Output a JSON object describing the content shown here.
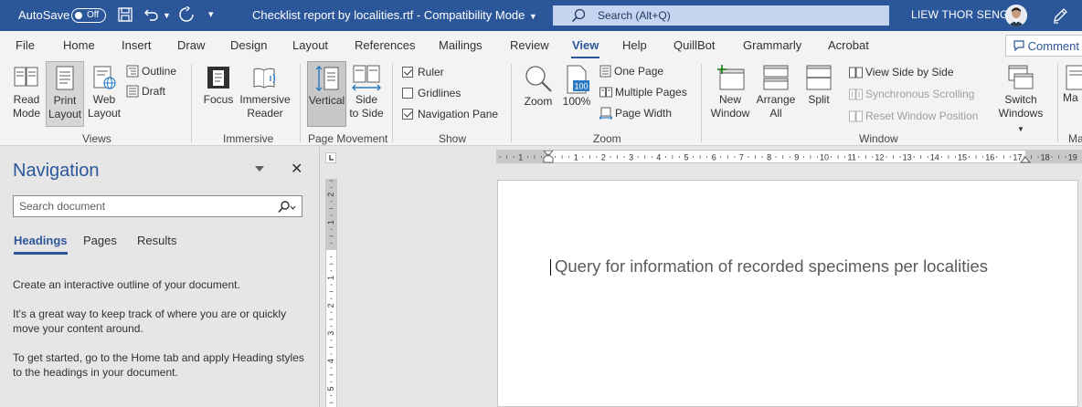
{
  "titlebar": {
    "autosave_label": "AutoSave",
    "autosave_state": "Off",
    "doc_title": "Checklist report by localities.rtf  -  Compatibility Mode",
    "search_placeholder": "Search (Alt+Q)",
    "user_name": "LIEW THOR SENG",
    "bg_color": "#2b579a"
  },
  "tabs": [
    "File",
    "Home",
    "Insert",
    "Draw",
    "Design",
    "Layout",
    "References",
    "Mailings",
    "Review",
    "View",
    "Help",
    "QuillBot",
    "Grammarly",
    "Acrobat"
  ],
  "active_tab": "View",
  "comments_label": "Comment",
  "ribbon": {
    "views": {
      "read_mode": [
        "Read",
        "Mode"
      ],
      "print_layout": [
        "Print",
        "Layout"
      ],
      "web_layout": [
        "Web",
        "Layout"
      ],
      "outline": "Outline",
      "draft": "Draft",
      "label": "Views"
    },
    "immersive": {
      "focus": "Focus",
      "immersive_reader": [
        "Immersive",
        "Reader"
      ],
      "label": "Immersive"
    },
    "page_movement": {
      "vertical": "Vertical",
      "side_to_side": [
        "Side",
        "to Side"
      ],
      "label": "Page Movement"
    },
    "show": {
      "ruler": "Ruler",
      "gridlines": "Gridlines",
      "navigation_pane": "Navigation Pane",
      "label": "Show"
    },
    "zoom": {
      "zoom": "Zoom",
      "hundred": "100%",
      "one_page": "One Page",
      "multiple_pages": "Multiple Pages",
      "page_width": "Page Width",
      "label": "Zoom"
    },
    "window": {
      "new_window": [
        "New",
        "Window"
      ],
      "arrange_all": [
        "Arrange",
        "All"
      ],
      "split": "Split",
      "view_side_by_side": "View Side by Side",
      "sync_scrolling": "Synchronous Scrolling",
      "reset_position": "Reset Window Position",
      "switch_windows": [
        "Switch",
        "Windows"
      ],
      "label": "Window"
    },
    "macros": {
      "label": "Ma",
      "button": "Ma"
    }
  },
  "navigation": {
    "title": "Navigation",
    "search_placeholder": "Search document",
    "tabs": [
      "Headings",
      "Pages",
      "Results"
    ],
    "paragraphs": [
      "Create an interactive outline of your document.",
      "It's a great way to keep track of where you are or quickly move your content around.",
      "To get started, go to the Home tab and apply Heading styles to the headings in your document."
    ]
  },
  "document": {
    "text": "Query for information of recorded specimens per localities"
  },
  "ruler": {
    "h_labels": [
      "1",
      "1",
      "2",
      "3",
      "4",
      "5",
      "6",
      "7",
      "8",
      "9",
      "10",
      "11",
      "12",
      "13",
      "14",
      "15",
      "16",
      "17",
      "18",
      "19"
    ],
    "v_labels": [
      "2",
      "1",
      "1",
      "2",
      "3",
      "4",
      "5"
    ]
  }
}
